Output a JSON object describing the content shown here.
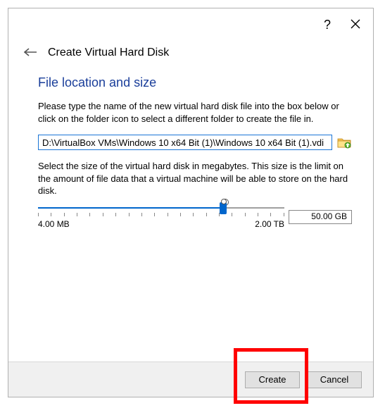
{
  "header": {
    "title": "Create Virtual Hard Disk"
  },
  "subtitle": "File location and size",
  "help1": "Please type the name of the new virtual hard disk file into the box below or click on the folder icon to select a different folder to create the file in.",
  "path": "D:\\VirtualBox VMs\\Windows 10 x64 Bit (1)\\Windows 10 x64 Bit (1).vdi",
  "help2": "Select the size of the virtual hard disk in megabytes. This size is the limit on the amount of file data that a virtual machine will be able to store on the hard disk.",
  "slider": {
    "min_label": "4.00 MB",
    "max_label": "2.00 TB",
    "value_label": "50.00 GB"
  },
  "buttons": {
    "create": "Create",
    "cancel": "Cancel"
  }
}
